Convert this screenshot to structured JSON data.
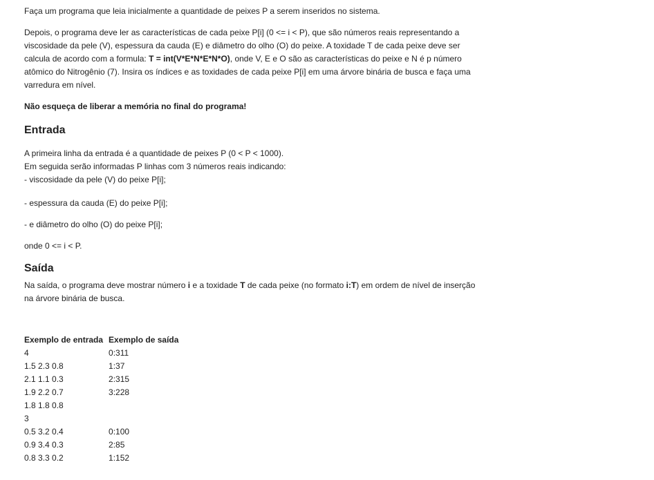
{
  "intro": "Faça um programa que leia inicialmente a quantidade de peixes P a serem inseridos no sistema.",
  "description": {
    "part1": "Depois, o programa deve ler as características de cada peixe P[i] (0 <= i < P), que são números reais representando a viscosidade da pele (V), espessura da cauda (E) e diâmetro do olho (O) do peixe. A toxidade T de cada peixe deve ser calcula de acordo com a formula: ",
    "formula": "T = int(V*E*N*E*N*O)",
    "part2": ", onde V, E e O são as características do peixe e N é p número atômico do Nitrogênio (7). Insira os índices e as toxidades de cada peixe P[i] em uma árvore binária de busca e faça uma varredura em nível."
  },
  "warning": "Não esqueça de liberar a memória no final do programa!",
  "entrada": {
    "heading": "Entrada",
    "line1": "A primeira linha da entrada é a quantidade de peixes P (0 < P < 1000).",
    "line2": "Em seguida serão informadas P linhas com 3 números reais indicando:",
    "line3": "- viscosidade da pele (V) do peixe P[i];",
    "line4": "- espessura da cauda (E) do peixe P[i];",
    "line5": "- e diâmetro do olho (O) do peixe P[i];",
    "line6": "onde 0 <= i < P."
  },
  "saida": {
    "heading": "Saída",
    "text1": "Na saída, o programa deve mostrar número ",
    "bold_i": "i",
    "text2": " e a toxidade ",
    "bold_T": "T",
    "text3": " de cada peixe (no formato ",
    "bold_format": "i:T",
    "text4": ") em ordem de nível de inserção na árvore binária de busca."
  },
  "examples": {
    "input_header": "Exemplo de entrada",
    "output_header": "Exemplo de saída",
    "rows": [
      {
        "input": [
          "4",
          "1.5 2.3 0.8",
          "2.1 1.1 0.3",
          "1.9 2.2 0.7",
          "1.8 1.8 0.8"
        ],
        "output": [
          "0:311",
          "1:37",
          "2:315",
          "3:228"
        ]
      },
      {
        "input": [
          "3",
          "0.5 3.2 0.4",
          "0.9 3.4 0.3",
          "0.8 3.3 0.2"
        ],
        "output": [
          "",
          "0:100",
          "2:85",
          "1:152"
        ]
      }
    ]
  }
}
